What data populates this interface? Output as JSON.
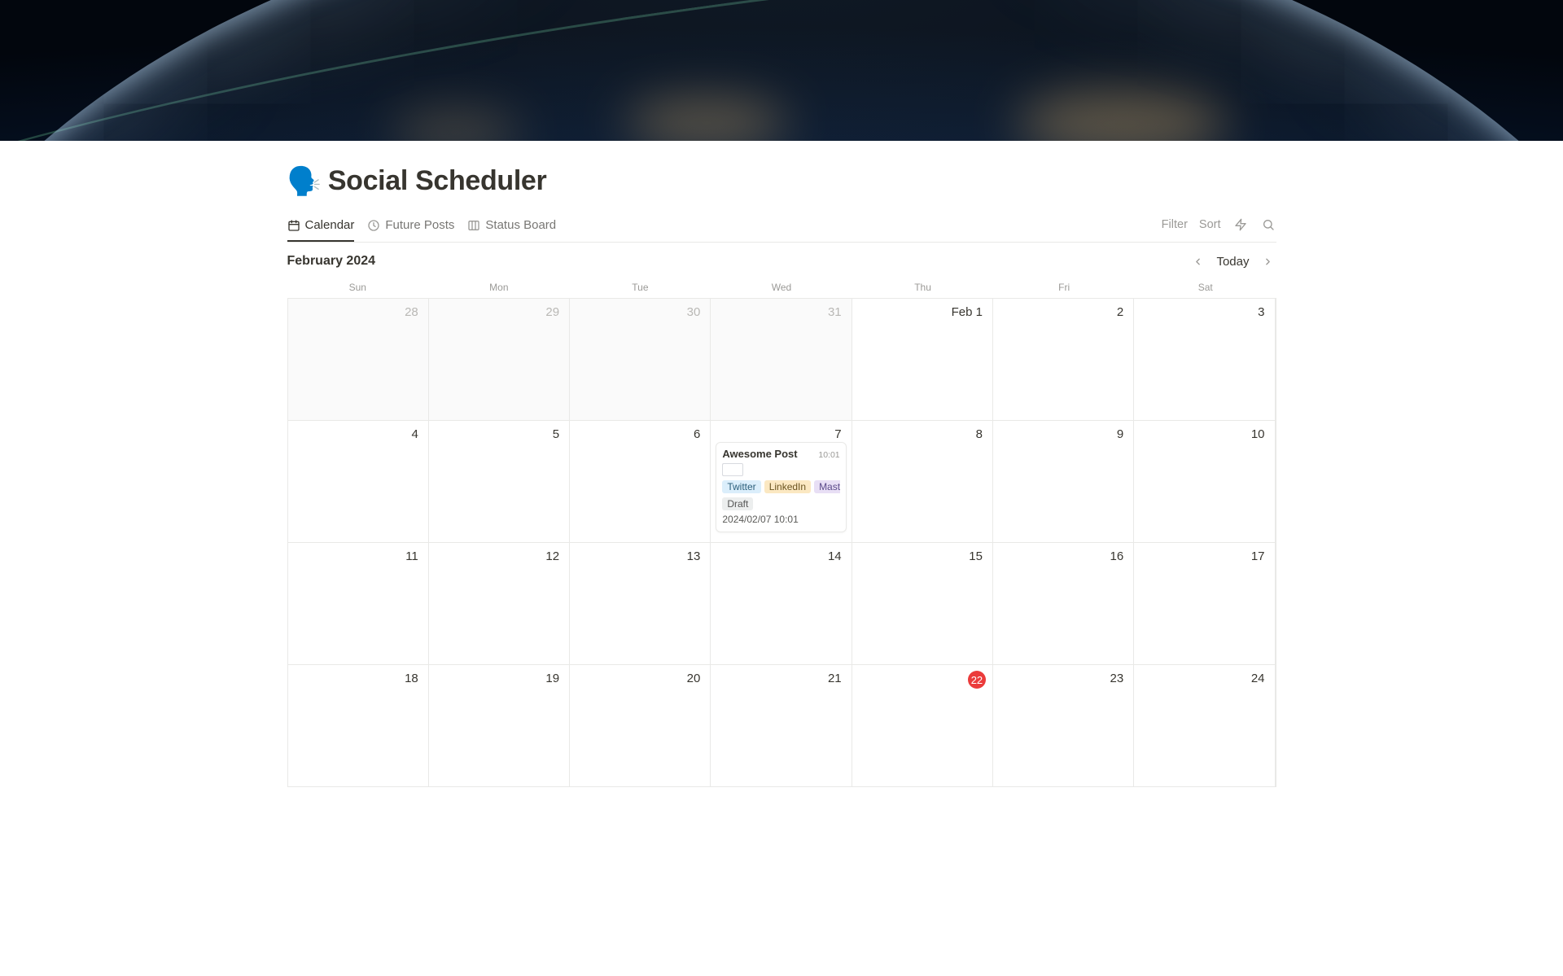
{
  "page": {
    "icon": "🗣️",
    "title": "Social Scheduler"
  },
  "views": {
    "tabs": [
      {
        "label": "Calendar",
        "icon": "calendar",
        "active": true
      },
      {
        "label": "Future Posts",
        "icon": "clock",
        "active": false
      },
      {
        "label": "Status Board",
        "icon": "board",
        "active": false
      }
    ],
    "actions": {
      "filter": "Filter",
      "sort": "Sort"
    }
  },
  "calendar": {
    "month_label": "February 2024",
    "today_label": "Today",
    "days_of_week": [
      "Sun",
      "Mon",
      "Tue",
      "Wed",
      "Thu",
      "Fri",
      "Sat"
    ],
    "today_day": 22,
    "weeks": [
      [
        {
          "label": "28",
          "out": true
        },
        {
          "label": "29",
          "out": true
        },
        {
          "label": "30",
          "out": true
        },
        {
          "label": "31",
          "out": true
        },
        {
          "label": "Feb 1"
        },
        {
          "label": "2"
        },
        {
          "label": "3"
        }
      ],
      [
        {
          "label": "4"
        },
        {
          "label": "5"
        },
        {
          "label": "6"
        },
        {
          "label": "7",
          "event_index": 0
        },
        {
          "label": "8"
        },
        {
          "label": "9"
        },
        {
          "label": "10"
        }
      ],
      [
        {
          "label": "11"
        },
        {
          "label": "12"
        },
        {
          "label": "13"
        },
        {
          "label": "14"
        },
        {
          "label": "15"
        },
        {
          "label": "16"
        },
        {
          "label": "17"
        }
      ],
      [
        {
          "label": "18"
        },
        {
          "label": "19"
        },
        {
          "label": "20"
        },
        {
          "label": "21"
        },
        {
          "label": "22",
          "today": true
        },
        {
          "label": "23"
        },
        {
          "label": "24"
        }
      ]
    ]
  },
  "events": [
    {
      "title": "Awesome Post",
      "time": "10:01",
      "tags": [
        {
          "text": "Twitter",
          "kind": "twitter"
        },
        {
          "text": "LinkedIn",
          "kind": "linkedin"
        },
        {
          "text": "Mastod",
          "kind": "mastodon"
        }
      ],
      "status": "Draft",
      "datetime": "2024/02/07 10:01"
    }
  ]
}
